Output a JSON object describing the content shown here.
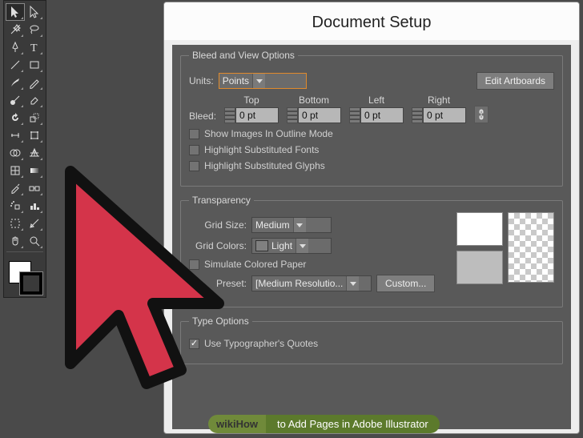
{
  "dialog": {
    "title": "Document Setup",
    "bleed_legend": "Bleed and View Options",
    "units_label": "Units:",
    "units_value": "Points",
    "edit_artboards": "Edit Artboards",
    "bleed_label": "Bleed:",
    "bleed_cols": {
      "top": "Top",
      "bottom": "Bottom",
      "left": "Left",
      "right": "Right"
    },
    "bleed_vals": {
      "top": "0 pt",
      "bottom": "0 pt",
      "left": "0 pt",
      "right": "0 pt"
    },
    "cb_outline": "Show Images In Outline Mode",
    "cb_sub_fonts": "Highlight Substituted Fonts",
    "cb_sub_glyphs": "Highlight Substituted Glyphs",
    "trans_legend": "Transparency",
    "grid_size_label": "Grid Size:",
    "grid_size_value": "Medium",
    "grid_colors_label": "Grid Colors:",
    "grid_colors_value": "Light",
    "cb_sim_paper": "Simulate Colored Paper",
    "preset_label": "Preset:",
    "preset_value": "[Medium Resolutio...",
    "custom_btn": "Custom...",
    "type_legend": "Type Options",
    "cb_typo_quotes": "Use Typographer's Quotes"
  },
  "watermark": {
    "left": "wikiHow",
    "right": "to Add Pages in Adobe Illustrator"
  },
  "tools": [
    [
      "selection",
      "direct-selection"
    ],
    [
      "magic-wand",
      "lasso"
    ],
    [
      "pen",
      "type"
    ],
    [
      "line-segment",
      "rectangle"
    ],
    [
      "paintbrush",
      "pencil"
    ],
    [
      "blob-brush",
      "eraser"
    ],
    [
      "rotate",
      "scale"
    ],
    [
      "width",
      "free-transform"
    ],
    [
      "shape-builder",
      "perspective-grid"
    ],
    [
      "mesh",
      "gradient"
    ],
    [
      "eyedropper",
      "blend"
    ],
    [
      "symbol-sprayer",
      "column-graph"
    ],
    [
      "artboard",
      "slice"
    ],
    [
      "hand",
      "zoom"
    ]
  ]
}
